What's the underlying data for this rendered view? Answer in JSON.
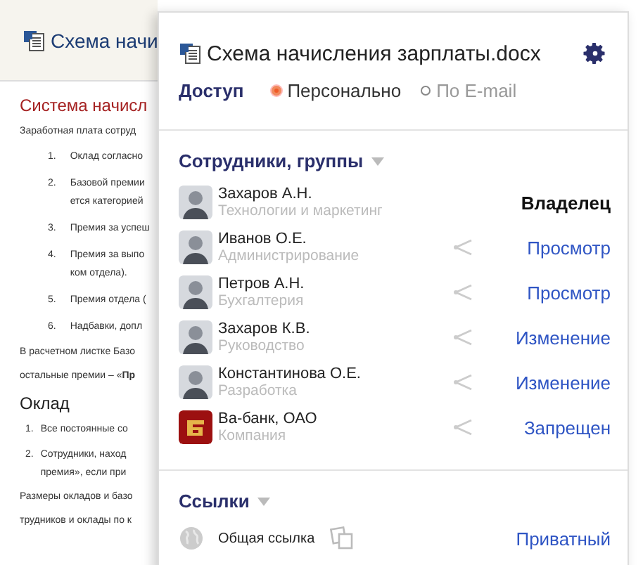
{
  "document": {
    "title": "Схема начи",
    "blocks": [
      {
        "kind": "h1",
        "text": "Система начисл"
      },
      {
        "kind": "p",
        "text": "Заработная плата сотруд"
      },
      {
        "kind": "li",
        "num": "1.",
        "lines": [
          "Оклад согласно"
        ]
      },
      {
        "kind": "li",
        "num": "2.",
        "lines": [
          "Базовой премии",
          "ется категорией"
        ]
      },
      {
        "kind": "li",
        "num": "3.",
        "lines": [
          "Премия за успеш"
        ]
      },
      {
        "kind": "li",
        "num": "4.",
        "lines": [
          "Премия за выпо",
          "ком отдела)."
        ]
      },
      {
        "kind": "li",
        "num": "5.",
        "lines": [
          "Премия отдела ("
        ]
      },
      {
        "kind": "li",
        "num": "6.",
        "lines": [
          "Надбавки, допл"
        ]
      },
      {
        "kind": "p",
        "text": "В расчетном листке Базо"
      },
      {
        "kind": "p",
        "text": "остальные премии – «**Пр**"
      },
      {
        "kind": "h2",
        "text": "Оклад"
      },
      {
        "kind": "li2",
        "num": "1.",
        "lines": [
          "Все постоянные со"
        ]
      },
      {
        "kind": "li2",
        "num": "2.",
        "lines": [
          "Сотрудники, наход",
          "премия», если при"
        ]
      },
      {
        "kind": "p",
        "text": "Размеры окладов и базо"
      },
      {
        "kind": "p",
        "text": "трудников и оклады по к"
      }
    ]
  },
  "panel": {
    "title": "Схема начисления зарплаты.docx",
    "access": {
      "label": "Доступ",
      "options": [
        {
          "label": "Персонально",
          "selected": true
        },
        {
          "label": "По E-mail",
          "selected": false
        }
      ]
    },
    "people": {
      "title": "Сотрудники, группы",
      "rows": [
        {
          "name": "Захаров А.Н.",
          "group": "Технологии и маркетинг",
          "kind": "person",
          "owner": true,
          "rights": "Владелец"
        },
        {
          "name": "Иванов О.Е.",
          "group": "Администрирование",
          "kind": "person",
          "owner": false,
          "rights": "Просмотр"
        },
        {
          "name": "Петров А.Н.",
          "group": "Бухгалтерия",
          "kind": "person",
          "owner": false,
          "rights": "Просмотр"
        },
        {
          "name": "Захаров К.В.",
          "group": "Руководство",
          "kind": "person",
          "owner": false,
          "rights": "Изменение"
        },
        {
          "name": "Константинова О.Е.",
          "group": "Разработка",
          "kind": "person",
          "owner": false,
          "rights": "Изменение"
        },
        {
          "name": "Ва-банк, ОАО",
          "group": "Компания",
          "kind": "company",
          "owner": false,
          "rights": "Запрещен"
        }
      ]
    },
    "links": {
      "title": "Ссылки",
      "rows": [
        {
          "label": "Общая ссылка",
          "rights": "Приватный"
        }
      ]
    }
  }
}
